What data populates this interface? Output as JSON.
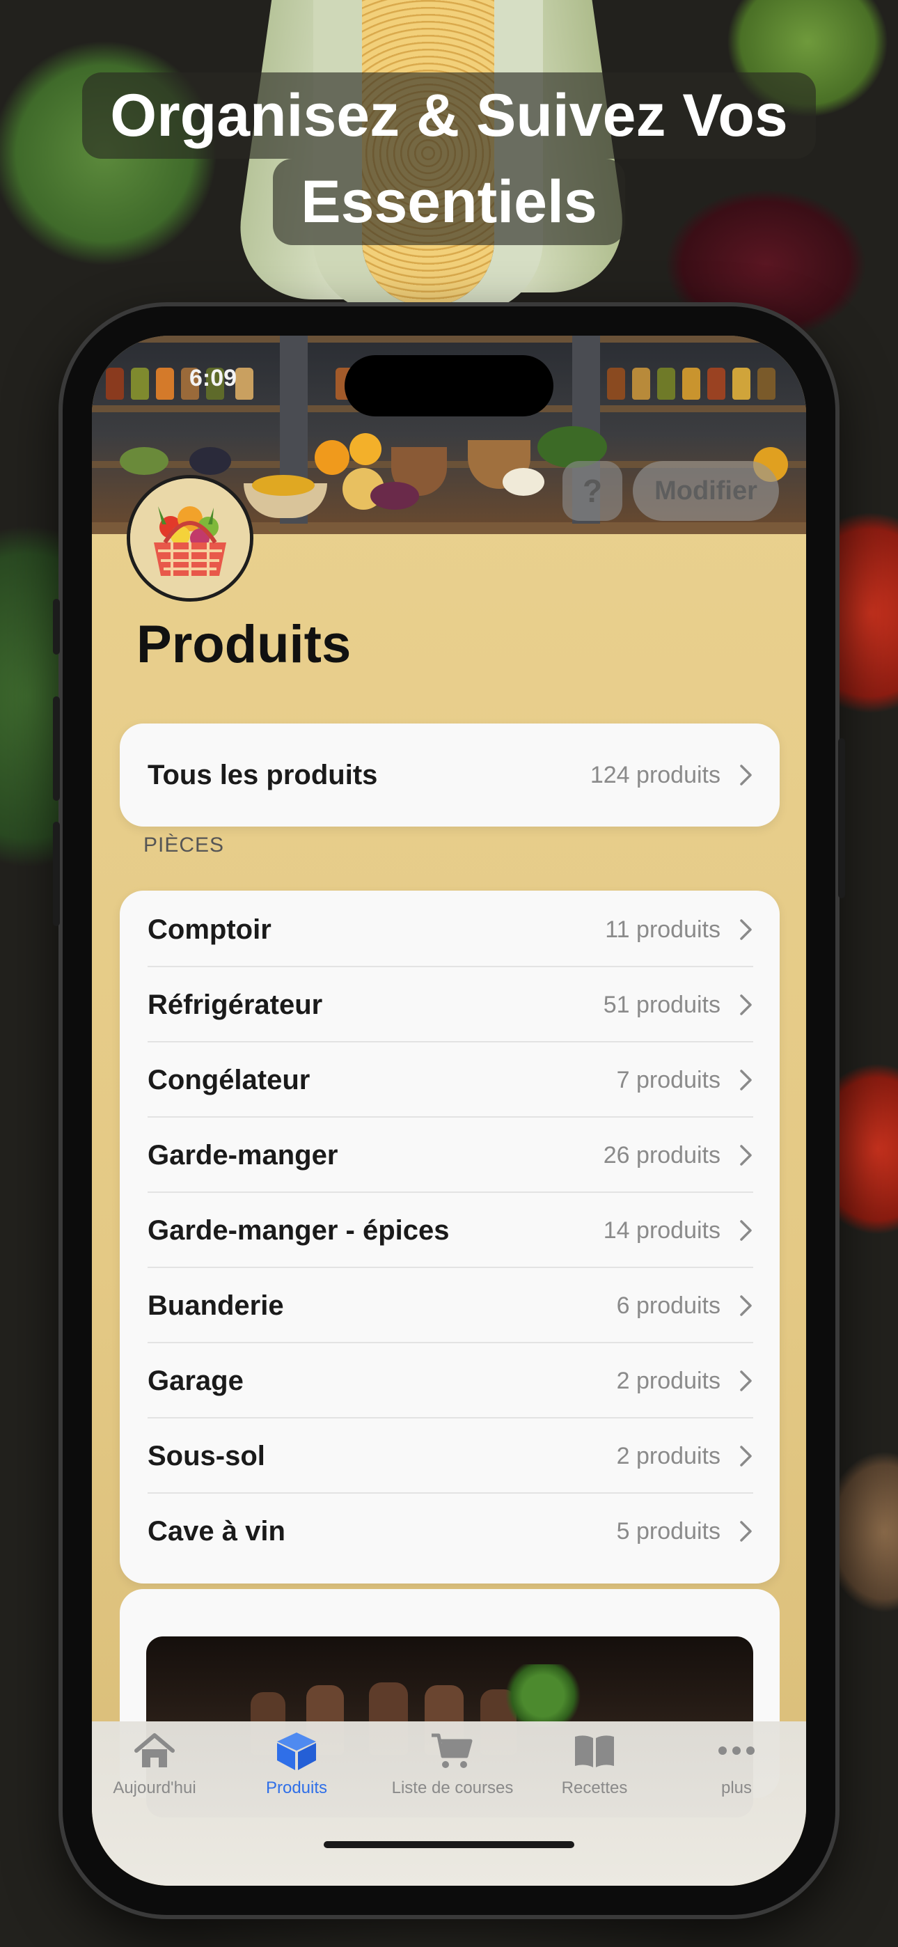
{
  "headline": {
    "line1": "Organisez & Suivez Vos",
    "line2": "Essentiels"
  },
  "status": {
    "time": "6:09"
  },
  "header": {
    "help_label": "?",
    "edit_label": "Modifier",
    "title": "Produits"
  },
  "all_products": {
    "label": "Tous les produits",
    "count": "124 produits"
  },
  "rooms": {
    "section_title": "PIÈCES",
    "items": [
      {
        "label": "Comptoir",
        "count": "11 produits"
      },
      {
        "label": "Réfrigérateur",
        "count": "51 produits"
      },
      {
        "label": "Congélateur",
        "count": "7 produits"
      },
      {
        "label": "Garde-manger",
        "count": "26 produits"
      },
      {
        "label": "Garde-manger - épices",
        "count": "14 produits"
      },
      {
        "label": "Buanderie",
        "count": "6 produits"
      },
      {
        "label": "Garage",
        "count": "2 produits"
      },
      {
        "label": "Sous-sol",
        "count": "2 produits"
      },
      {
        "label": "Cave à vin",
        "count": "5 produits"
      }
    ]
  },
  "tabs": [
    {
      "label": "Aujourd'hui",
      "icon": "house-icon",
      "active": false
    },
    {
      "label": "Produits",
      "icon": "cube-icon",
      "active": true
    },
    {
      "label": "Liste de courses",
      "icon": "cart-icon",
      "active": false
    },
    {
      "label": "Recettes",
      "icon": "book-icon",
      "active": false
    },
    {
      "label": "plus",
      "icon": "more-dots-icon",
      "active": false
    }
  ],
  "colors": {
    "accent": "#2f6fe8",
    "screen_background": "#e4c985",
    "card_background": "#f9f9f9"
  }
}
